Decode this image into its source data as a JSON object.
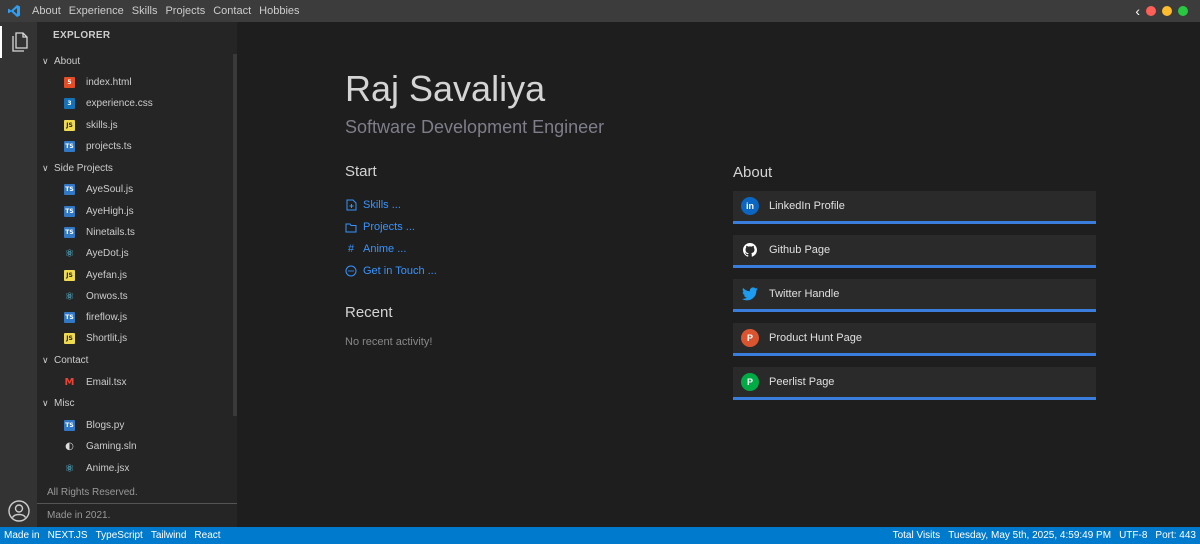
{
  "menu": [
    "About",
    "Experience",
    "Skills",
    "Projects",
    "Contact",
    "Hobbies"
  ],
  "colors": {
    "close": "#ff5f57",
    "minimize": "#febc2e",
    "maximize": "#28c840",
    "accent": "#007acc",
    "link": "#3794ff",
    "card_bar": "#3b7ddd"
  },
  "sidebar": {
    "title": "EXPLORER",
    "folders": [
      {
        "label": "About",
        "files": [
          {
            "name": "index.html",
            "icon": "html"
          },
          {
            "name": "experience.css",
            "icon": "css"
          },
          {
            "name": "skills.js",
            "icon": "js"
          },
          {
            "name": "projects.ts",
            "icon": "ts"
          }
        ]
      },
      {
        "label": "Side Projects",
        "files": [
          {
            "name": "AyeSoul.js",
            "icon": "ts"
          },
          {
            "name": "AyeHigh.js",
            "icon": "ts"
          },
          {
            "name": "Ninetails.ts",
            "icon": "ts"
          },
          {
            "name": "AyeDot.js",
            "icon": "react"
          },
          {
            "name": "Ayefan.js",
            "icon": "js"
          },
          {
            "name": "Onwos.ts",
            "icon": "react"
          },
          {
            "name": "fireflow.js",
            "icon": "ts"
          },
          {
            "name": "Shortlit.js",
            "icon": "js"
          }
        ]
      },
      {
        "label": "Contact",
        "files": [
          {
            "name": "Email.tsx",
            "icon": "gmail"
          }
        ]
      },
      {
        "label": "Misc",
        "files": [
          {
            "name": "Blogs.py",
            "icon": "ts"
          },
          {
            "name": "Gaming.sln",
            "icon": "csharp"
          },
          {
            "name": "Anime.jsx",
            "icon": "react"
          }
        ]
      }
    ],
    "footer_rights": "All Rights Reserved.",
    "footer_made": "Made in 2021."
  },
  "main": {
    "name": "Raj Savaliya",
    "role": "Software Development Engineer",
    "start_heading": "Start",
    "start_links": [
      {
        "label": "Skills ...",
        "icon": "new-file-icon"
      },
      {
        "label": "Projects ...",
        "icon": "folder-icon"
      },
      {
        "label": "Anime ...",
        "icon": "hash-icon"
      },
      {
        "label": "Get in Touch ...",
        "icon": "chat-icon"
      }
    ],
    "recent_heading": "Recent",
    "recent_empty": "No recent activity!",
    "about_heading": "About",
    "about_links": [
      {
        "label": "LinkedIn Profile",
        "icon": "linkedin-icon",
        "icon_text": "in",
        "color": "#0a66c2"
      },
      {
        "label": "Github Page",
        "icon": "github-icon",
        "icon_text": "",
        "color": "#2b2b2b"
      },
      {
        "label": "Twitter Handle",
        "icon": "twitter-icon",
        "icon_text": "",
        "color": "#1d9bf0"
      },
      {
        "label": "Product Hunt Page",
        "icon": "producthunt-icon",
        "icon_text": "P",
        "color": "#da552f"
      },
      {
        "label": "Peerlist Page",
        "icon": "peerlist-icon",
        "icon_text": "P",
        "color": "#00aa45"
      }
    ]
  },
  "status": {
    "made_in": "Made in",
    "tech": [
      "NEXT.JS",
      "TypeScript",
      "Tailwind",
      "React"
    ],
    "total_visits": "Total Visits",
    "datetime": "Tuesday, May 5th, 2025, 4:59:49 PM",
    "encoding": "UTF-8",
    "port": "Port: 443"
  }
}
